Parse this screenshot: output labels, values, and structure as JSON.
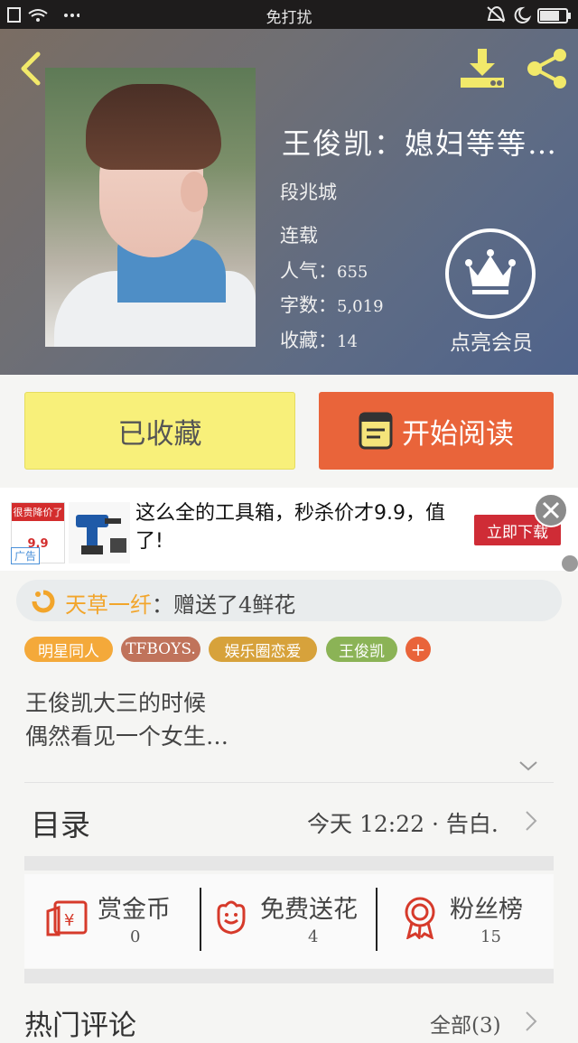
{
  "status_bar": {
    "center_text": "免打扰"
  },
  "book": {
    "title": "王俊凯：媳妇等等…",
    "author": "段兆城",
    "status": "连载",
    "popularity_label": "人气：",
    "popularity": "655",
    "words_label": "字数：",
    "words": "5,019",
    "favorites_label": "收藏：",
    "favorites": "14"
  },
  "vip": {
    "label": "点亮会员"
  },
  "actions": {
    "favorited_label": "已收藏",
    "read_label": "开始阅读"
  },
  "ad": {
    "thumb_text": "很贵降价了",
    "thumb_price": "9.9",
    "text": "这么全的工具箱，秒杀价才9.9，值了!",
    "cta": "立即下载",
    "label": "广告"
  },
  "gift": {
    "user": "天草一纤",
    "message": "：赠送了4鲜花"
  },
  "tags": [
    {
      "label": "明星同人",
      "color": "#f4a93a"
    },
    {
      "label": "TFBOYS.",
      "color": "#c0735b"
    },
    {
      "label": "娱乐圈恋爱",
      "color": "#d7a23b"
    },
    {
      "label": "王俊凯",
      "color": "#8bb356"
    },
    {
      "label": "+",
      "color": "#e9643a"
    }
  ],
  "summary": {
    "line1": "王俊凯大三的时候",
    "line2": "偶然看见一个女生…"
  },
  "toc": {
    "label": "目录",
    "latest": "今天 12:22 · 告白."
  },
  "stats": [
    {
      "label": "赏金币",
      "value": "0",
      "icon": "red-envelope-icon"
    },
    {
      "label": "免费送花",
      "value": "4",
      "icon": "flower-icon"
    },
    {
      "label": "粉丝榜",
      "value": "15",
      "icon": "medal-icon"
    }
  ],
  "comments": {
    "label": "热门评论",
    "all": "全部(3)"
  },
  "colors": {
    "accent_orange": "#e9643a",
    "fav_yellow": "#f8f07a",
    "icon_yellow": "#f2e96a",
    "stat_red": "#d63a2b"
  }
}
